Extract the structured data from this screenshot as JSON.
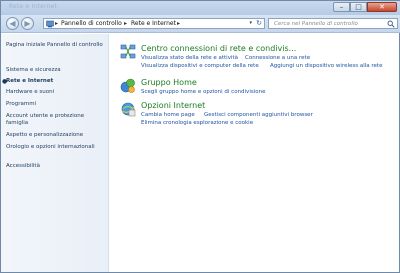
{
  "window": {
    "title": "Rete e Internet",
    "controls": {
      "minimize": "–",
      "maximize": "□",
      "close": "✕"
    }
  },
  "navigation": {
    "back_glyph": "◀",
    "forward_glyph": "▶",
    "address": {
      "breadcrumbs": [
        "Pannello di controllo",
        "Rete e Internet"
      ],
      "separator": "▸",
      "dropdown_glyph": "▾",
      "refresh_glyph": "↻"
    },
    "search": {
      "placeholder": "Cerca nel Pannello di controllo"
    }
  },
  "sidebar": {
    "items": [
      {
        "label": "Pagina iniziale Pannello di controllo"
      },
      {
        "label": "Sistema e sicurezza"
      },
      {
        "label": "Rete e Internet",
        "active": true,
        "bullet": "●"
      },
      {
        "label": "Hardware e suoni"
      },
      {
        "label": "Programmi"
      },
      {
        "label": "Account utente e protezione famiglia"
      },
      {
        "label": "Aspetto e personalizzazione"
      },
      {
        "label": "Orologio e opzioni internazionali"
      },
      {
        "label": "Accessibilità"
      }
    ]
  },
  "main": {
    "categories": [
      {
        "title": "Centro connessioni di rete e condivis...",
        "icon": "network-center-icon",
        "tasks": [
          "Visualizza stato della rete e attività",
          "Connessione a una rete",
          "Visualizza dispositivi e computer della rete",
          "Aggiungi un dispositivo wireless alla rete"
        ]
      },
      {
        "title": "Gruppo Home",
        "icon": "homegroup-icon",
        "tasks": [
          "Scegli gruppo home e opzioni di condivisione"
        ]
      },
      {
        "title": "Opzioni Internet",
        "icon": "internet-options-icon",
        "tasks": [
          "Cambia home page",
          "Gestisci componenti aggiuntivi browser",
          "Elimina cronologia esplorazione e cookie"
        ]
      }
    ]
  },
  "colors": {
    "category_title": "#1a7d22",
    "task_link": "#1e52a3",
    "sidebar_text": "#1e395b"
  }
}
